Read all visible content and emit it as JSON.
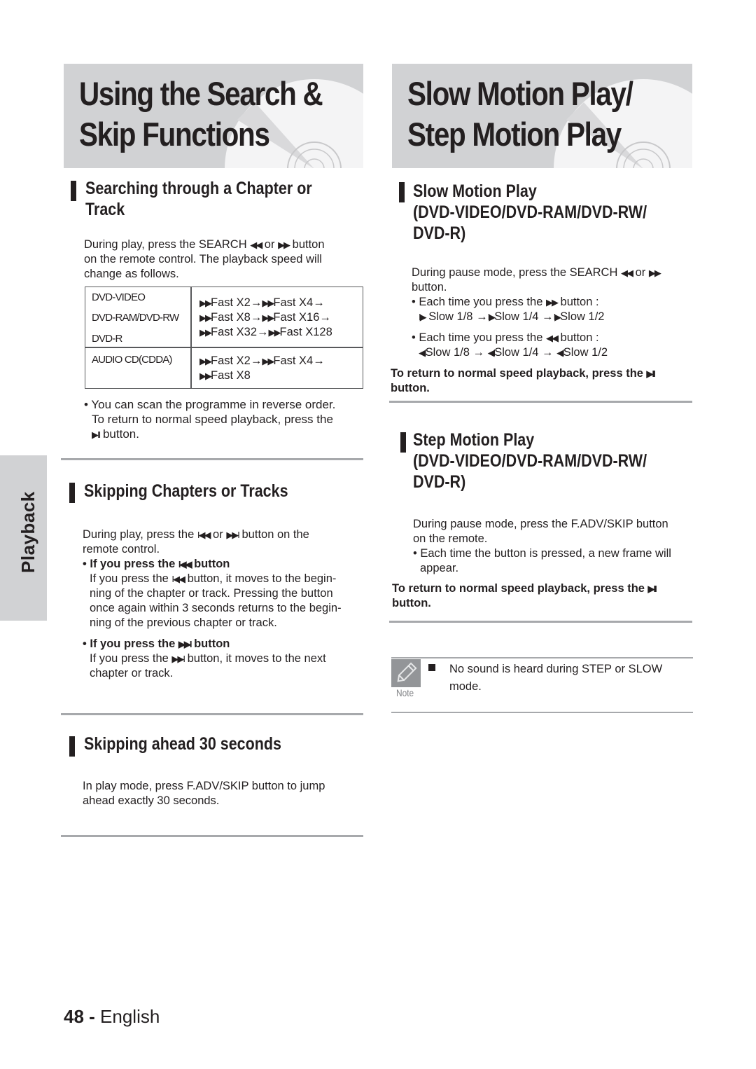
{
  "side_tab": {
    "label": "Playback"
  },
  "left_column": {
    "banner_title_line1": "Using the Search &",
    "banner_title_line2": "Skip Functions",
    "section1": {
      "heading_line1": "Searching through a Chapter or",
      "heading_line2": "Track",
      "intro_line1_a": "During play, press the SEARCH ",
      "intro_line1_b": " or ",
      "intro_line1_c": " button",
      "intro_line2": "on the remote control. The playback speed will",
      "intro_line3": "change as follows.",
      "table": {
        "rows": [
          {
            "discs": [
              "DVD-VIDEO",
              "DVD-RAM/DVD-RW",
              "DVD-R"
            ],
            "speeds": [
              "Fast X2→",
              "Fast X4→",
              "Fast X8→",
              "Fast X16→",
              "Fast X32→",
              "Fast X128"
            ]
          },
          {
            "discs": [
              "AUDIO CD(CDDA)"
            ],
            "speeds": [
              "Fast X2→",
              "Fast X4→",
              "Fast X8"
            ]
          }
        ]
      },
      "bullet_line1": "• You can scan the programme in reverse order.",
      "bullet_line2": "To return to normal speed playback, press the",
      "bullet_line3": " button."
    },
    "section2": {
      "heading": "Skipping Chapters or Tracks",
      "intro_line1_a": "During play, press the ",
      "intro_line1_b": " or ",
      "intro_line1_c": " button on the",
      "intro_line2": "remote control.",
      "prev_head_a": "• If you press the ",
      "prev_head_b": " button",
      "prev_body_line1_a": "If you press the ",
      "prev_body_line1_b": " button, it moves to the begin-",
      "prev_body_line2": "ning of the chapter or track. Pressing the button",
      "prev_body_line3": "once again within 3 seconds returns to the begin-",
      "prev_body_line4": "ning of  the previous chapter or track.",
      "next_head_a": "• If you press the ",
      "next_head_b": " button",
      "next_body_line1_a": "If you press the ",
      "next_body_line1_b": " button, it moves to the next",
      "next_body_line2": "chapter or track."
    },
    "section3": {
      "heading": "Skipping ahead 30 seconds",
      "body_line1": "In play mode, press F.ADV/SKIP button to jump",
      "body_line2": "ahead exactly 30 seconds."
    }
  },
  "right_column": {
    "banner_title_line1": "Slow Motion Play/",
    "banner_title_line2": "Step Motion Play",
    "section1": {
      "heading_line1": "Slow Motion Play",
      "heading_line2": "(DVD-VIDEO/DVD-RAM/DVD-RW/",
      "heading_line3": "DVD-R)",
      "intro_line1_a": "During pause mode, press the SEARCH ",
      "intro_line1_b": " or ",
      "intro_line2": "button.",
      "fwd_head_a": "• Each time you press the ",
      "fwd_head_b": " button :",
      "fwd_steps": [
        "Slow 1/8 →",
        "Slow 1/4 →",
        "Slow 1/2"
      ],
      "rev_head_a": "• Each time you press the ",
      "rev_head_b": " button :",
      "rev_steps": [
        "Slow 1/8 →",
        "Slow 1/4 →",
        "Slow 1/2"
      ],
      "return_line1": "To return to normal speed playback, press the ",
      "return_line2": "button."
    },
    "section2": {
      "heading_line1": "Step Motion Play",
      "heading_line2": "(DVD-VIDEO/DVD-RAM/DVD-RW/",
      "heading_line3": "DVD-R)",
      "intro_line1": "During pause mode, press the F.ADV/SKIP button",
      "intro_line2": "on the remote.",
      "bullet_line1": "• Each time the button is pressed, a new frame will",
      "bullet_line2": "appear.",
      "return_line1": "To return to normal speed playback, press the ",
      "return_line2": "button."
    },
    "note": {
      "label": "Note",
      "text_line1": "No sound is heard during STEP or SLOW",
      "text_line2": "mode."
    }
  },
  "icons": {
    "rewind": "◀◀",
    "fast_forward": "▶▶",
    "play_pause": "▶II",
    "skip_prev": "I◀◀",
    "skip_next": "▶▶I",
    "slow_fwd": "I▶",
    "slow_rev": "◀I"
  },
  "footer": {
    "page_number": "48",
    "separator": " - ",
    "language": "English"
  }
}
